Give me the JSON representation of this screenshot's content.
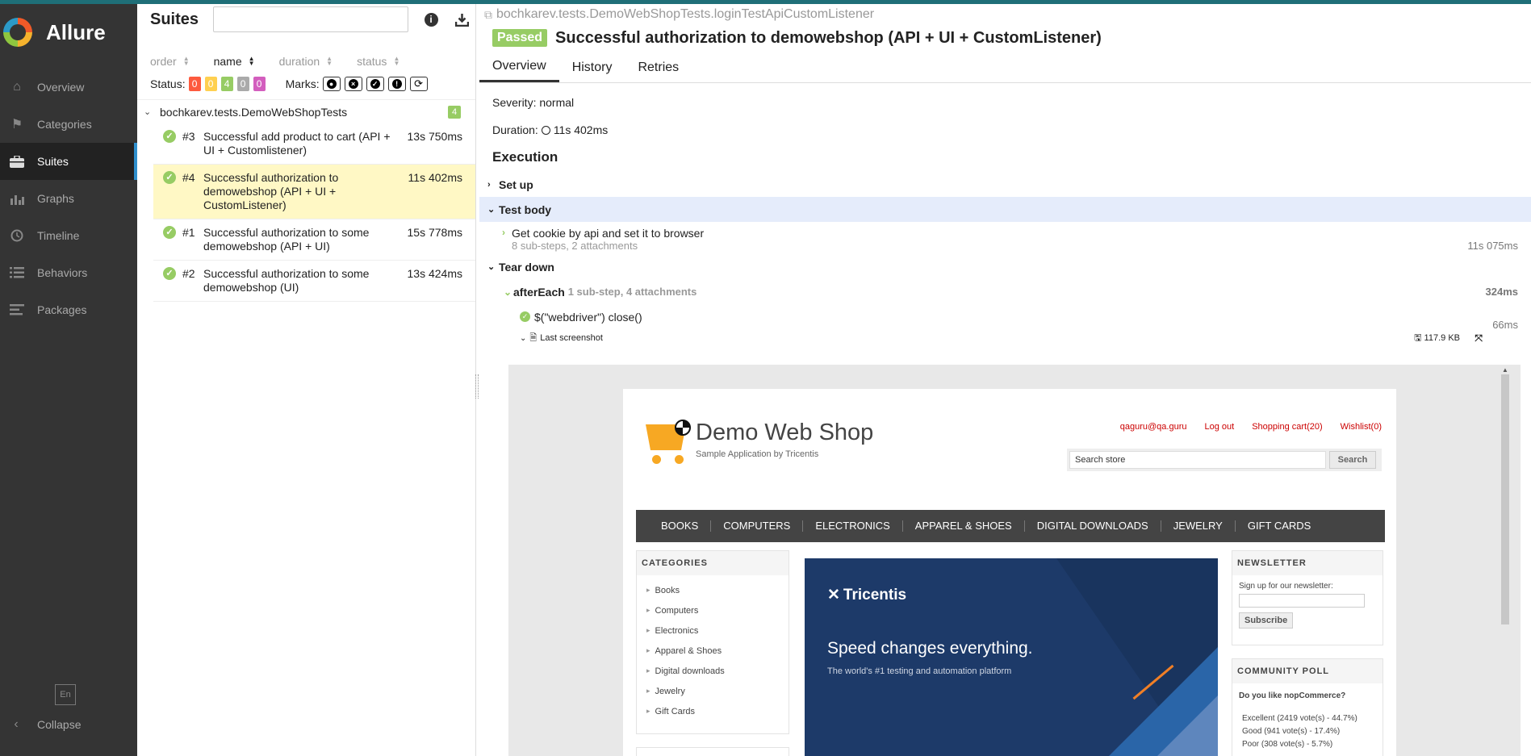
{
  "colors": {
    "passed": "#97cc64",
    "failed": "#fd5a3e",
    "broken": "#ffd050",
    "skipped": "#aaaaaa",
    "unknown": "#d35ebe",
    "nav_bg": "#343434",
    "accent": "#2f8fcd",
    "selected_row": "#fff8c5"
  },
  "nav": {
    "logo": "Allure",
    "items": [
      {
        "label": "Overview",
        "icon": "home-icon"
      },
      {
        "label": "Categories",
        "icon": "flag-icon"
      },
      {
        "label": "Suites",
        "icon": "briefcase-icon"
      },
      {
        "label": "Graphs",
        "icon": "bar-chart-icon"
      },
      {
        "label": "Timeline",
        "icon": "clock-icon"
      },
      {
        "label": "Behaviors",
        "icon": "list-icon"
      },
      {
        "label": "Packages",
        "icon": "align-left-icon"
      }
    ],
    "lang": "En",
    "collapse": "Collapse"
  },
  "suites": {
    "title": "Suites",
    "search_placeholder": "",
    "sort": {
      "order": "order",
      "name": "name",
      "duration": "duration",
      "status": "status"
    },
    "status_label": "Status:",
    "counts": [
      "0",
      "0",
      "4",
      "0",
      "0"
    ],
    "marks_label": "Marks:",
    "group": {
      "name": "bochkarev.tests.DemoWebShopTests",
      "count": "4"
    },
    "tests": [
      {
        "num": "#3",
        "name": "Successful add product to cart (API + UI + Customlistener)",
        "duration": "13s 750ms"
      },
      {
        "num": "#4",
        "name": "Successful authorization to demowebshop (API + UI + CustomListener)",
        "duration": "11s 402ms"
      },
      {
        "num": "#1",
        "name": "Successful authorization to some demowebshop (API + UI)",
        "duration": "15s 778ms"
      },
      {
        "num": "#2",
        "name": "Successful authorization to some demowebshop (UI)",
        "duration": "13s 424ms"
      }
    ]
  },
  "detail": {
    "path": "bochkarev.tests.DemoWebShopTests.loginTestApiCustomListener",
    "status": "Passed",
    "title": "Successful authorization to demowebshop (API + UI + CustomListener)",
    "tabs": [
      "Overview",
      "History",
      "Retries"
    ],
    "severity": "Severity: normal",
    "duration_label": "Duration:",
    "duration": "11s 402ms",
    "execution": "Execution",
    "setup": "Set up",
    "test_body": "Test body",
    "body_step": {
      "name": "Get cookie by api and set it to browser",
      "meta": "8 sub-steps, 2 attachments",
      "duration": "11s 075ms"
    },
    "teardown": "Tear down",
    "after_each": {
      "name": "afterEach",
      "meta": "1 sub-step, 4 attachments",
      "duration": "324ms"
    },
    "close_step": {
      "name": "$(\"webdriver\") close()",
      "duration": "66ms"
    },
    "attachment": {
      "name": "Last screenshot",
      "size": "117.9 KB"
    }
  },
  "shot": {
    "site_name": "Demo Web Shop",
    "site_sub": "Sample Application by Tricentis",
    "links": [
      "qaguru@qa.guru",
      "Log out",
      "Shopping cart(20)",
      "Wishlist(0)"
    ],
    "search_value": "Search store",
    "search_btn": "Search",
    "menu": [
      "BOOKS",
      "COMPUTERS",
      "ELECTRONICS",
      "APPAREL & SHOES",
      "DIGITAL DOWNLOADS",
      "JEWELRY",
      "GIFT CARDS"
    ],
    "categories_title": "CATEGORIES",
    "categories": [
      "Books",
      "Computers",
      "Electronics",
      "Apparel & Shoes",
      "Digital downloads",
      "Jewelry",
      "Gift Cards"
    ],
    "banner_brand": "Tricentis",
    "banner_tagline": "Speed changes everything.",
    "banner_sub": "The world's #1 testing and automation platform",
    "newsletter_title": "NEWSLETTER",
    "newsletter_text": "Sign up for our newsletter:",
    "subscribe": "Subscribe",
    "poll_title": "COMMUNITY POLL",
    "poll_question": "Do you like nopCommerce?",
    "poll_answers": [
      "Excellent (2419 vote(s) - 44.7%)",
      "Good (941 vote(s) - 17.4%)",
      "Poor (308 vote(s) - 5.7%)"
    ]
  }
}
